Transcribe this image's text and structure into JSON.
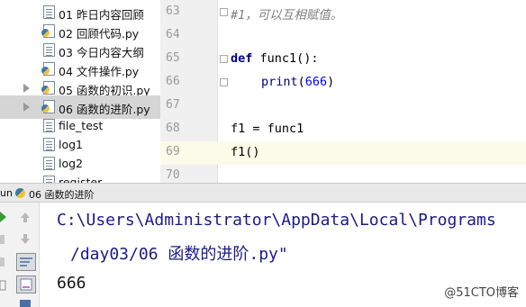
{
  "project_tree": {
    "items": [
      {
        "label": "01 昨日内容回顾",
        "icon": "text-file-icon",
        "expandable": false,
        "selected": false
      },
      {
        "label": "02 回顾代码.py",
        "icon": "python-file-icon",
        "expandable": false,
        "selected": false
      },
      {
        "label": "03 今日内容大纲",
        "icon": "text-file-icon",
        "expandable": false,
        "selected": false
      },
      {
        "label": "04 文件操作.py",
        "icon": "python-file-icon",
        "expandable": false,
        "selected": false
      },
      {
        "label": "05 函数的初识.py",
        "icon": "python-file-icon",
        "expandable": true,
        "selected": false
      },
      {
        "label": "06 函数的进阶.py",
        "icon": "python-file-icon",
        "expandable": true,
        "selected": true
      },
      {
        "label": "file_test",
        "icon": "text-file-icon",
        "expandable": false,
        "selected": false
      },
      {
        "label": "log1",
        "icon": "text-file-icon",
        "expandable": false,
        "selected": false
      },
      {
        "label": "log2",
        "icon": "text-file-icon",
        "expandable": false,
        "selected": false
      },
      {
        "label": "register",
        "icon": "text-file-icon",
        "expandable": false,
        "selected": false
      }
    ]
  },
  "editor": {
    "current_line": "69",
    "lines": [
      {
        "num": "63",
        "comment": "#1，可以互相赋值。"
      },
      {
        "num": "64"
      },
      {
        "num": "65",
        "kw": "def",
        "text": " func1():"
      },
      {
        "num": "66",
        "builtin": "print",
        "paren_open": "(",
        "number": "666",
        "paren_close": ")"
      },
      {
        "num": "67"
      },
      {
        "num": "68",
        "text": "f1 = func1"
      },
      {
        "num": "69",
        "text": "f1()"
      },
      {
        "num": "70"
      }
    ]
  },
  "run_panel": {
    "tab_label": "un",
    "title": "06 函数的进阶",
    "output": {
      "path_line1": "C:\\Users\\Administrator\\AppData\\Local\\Programs",
      "path_line2": "/day03/06 函数的进阶.py\"",
      "result": "666"
    }
  },
  "watermark": "@51CTO博客",
  "colors": {
    "selected_row": "#d5d5d5",
    "current_line": "#fcfae8",
    "keyword": "#000080",
    "number": "#0000ff",
    "comment": "#808080",
    "console_path": "#1a1a8a"
  }
}
